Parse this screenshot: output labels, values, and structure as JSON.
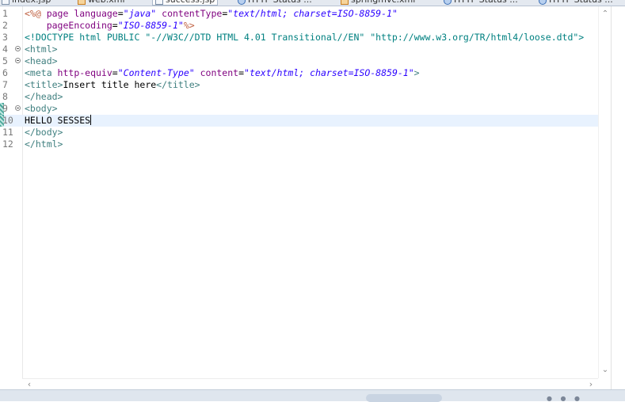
{
  "tabs": [
    {
      "label": "index.jsp",
      "icon": "jsp-file-icon"
    },
    {
      "label": "web.xml",
      "icon": "xml-file-icon"
    },
    {
      "label": "success.jsp",
      "icon": "jsp-file-icon",
      "active": true
    },
    {
      "label": "HTTP Status ...",
      "icon": "browser-icon"
    },
    {
      "label": "springmvc.xml",
      "icon": "xml-file-icon"
    },
    {
      "label": "HTTP Status ...",
      "icon": "browser-icon"
    },
    {
      "label": "HTTP Status ...",
      "icon": "browser-icon"
    }
  ],
  "editor": {
    "lines": [
      {
        "num": "1",
        "segments": [
          {
            "t": "jsp",
            "v": "<%@ "
          },
          {
            "t": "attr",
            "v": "page "
          },
          {
            "t": "attr",
            "v": "language"
          },
          {
            "t": "plain",
            "v": "="
          },
          {
            "t": "str",
            "v": "\"java\""
          },
          {
            "t": "plain",
            "v": " "
          },
          {
            "t": "attr",
            "v": "contentType"
          },
          {
            "t": "plain",
            "v": "="
          },
          {
            "t": "str",
            "v": "\"text/html; charset=ISO-8859-1\""
          }
        ]
      },
      {
        "num": "2",
        "segments": [
          {
            "t": "plain",
            "v": "    "
          },
          {
            "t": "attr",
            "v": "pageEncoding"
          },
          {
            "t": "plain",
            "v": "="
          },
          {
            "t": "str",
            "v": "\"ISO-8859-1\""
          },
          {
            "t": "jsp",
            "v": "%>"
          }
        ]
      },
      {
        "num": "3",
        "segments": [
          {
            "t": "doctype",
            "v": "<!DOCTYPE "
          },
          {
            "t": "doctype",
            "v": "html PUBLIC "
          },
          {
            "t": "doctype",
            "v": "\"-//W3C//DTD HTML 4.01 Transitional//EN\" \"http://www.w3.org/TR/html4/loose.dtd\">"
          }
        ]
      },
      {
        "num": "4",
        "fold": true,
        "segments": [
          {
            "t": "tag",
            "v": "<html>"
          }
        ]
      },
      {
        "num": "5",
        "fold": true,
        "segments": [
          {
            "t": "tag",
            "v": "<head>"
          }
        ]
      },
      {
        "num": "6",
        "segments": [
          {
            "t": "tag",
            "v": "<meta "
          },
          {
            "t": "attr",
            "v": "http-equiv"
          },
          {
            "t": "plain",
            "v": "="
          },
          {
            "t": "str",
            "v": "\"Content-Type\""
          },
          {
            "t": "plain",
            "v": " "
          },
          {
            "t": "attr",
            "v": "content"
          },
          {
            "t": "plain",
            "v": "="
          },
          {
            "t": "str",
            "v": "\"text/html; charset=ISO-8859-1\""
          },
          {
            "t": "tag",
            "v": ">"
          }
        ]
      },
      {
        "num": "7",
        "segments": [
          {
            "t": "tag",
            "v": "<title>"
          },
          {
            "t": "plain",
            "v": "Insert title here"
          },
          {
            "t": "tag",
            "v": "</title>"
          }
        ]
      },
      {
        "num": "8",
        "segments": [
          {
            "t": "tag",
            "v": "</head>"
          }
        ]
      },
      {
        "num": "9",
        "fold": true,
        "changed": true,
        "segments": [
          {
            "t": "tag",
            "v": "<body>"
          }
        ]
      },
      {
        "num": "10",
        "current": true,
        "changed": true,
        "cursor": true,
        "segments": [
          {
            "t": "plain",
            "v": "HELLO SESSES"
          }
        ]
      },
      {
        "num": "11",
        "segments": [
          {
            "t": "tag",
            "v": "</body>"
          }
        ]
      },
      {
        "num": "12",
        "segments": [
          {
            "t": "tag",
            "v": "</html>"
          }
        ]
      }
    ]
  },
  "scrollbars": {
    "up": "⌃",
    "down": "⌄",
    "left": "‹",
    "right": "›"
  }
}
